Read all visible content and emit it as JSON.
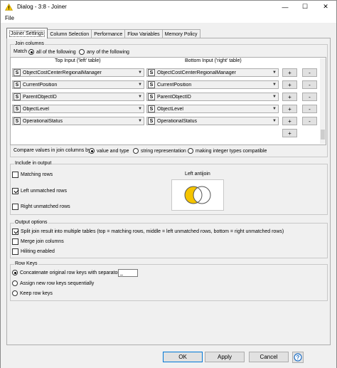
{
  "window": {
    "title": "Dialog - 3:8 - Joiner",
    "minimize_glyph": "—",
    "maximize_glyph": "☐",
    "close_glyph": "✕"
  },
  "menu": {
    "file": "File"
  },
  "tabs": [
    {
      "label": "Joiner Settings",
      "active": true
    },
    {
      "label": "Column Selection"
    },
    {
      "label": "Performance"
    },
    {
      "label": "Flow Variables"
    },
    {
      "label": "Memory Policy"
    }
  ],
  "join_columns": {
    "legend": "Join columns",
    "match_label": "Match",
    "match_all": "all of the following",
    "match_any": "any of the following",
    "top_header": "Top Input ('left' table)",
    "bottom_header": "Bottom Input ('right' table)",
    "type_badge": "S",
    "add_label": "+",
    "remove_label": "-",
    "rows": [
      {
        "left": "ObjectCostCenterRegionalManager",
        "right": "ObjectCostCenterRegionalManager"
      },
      {
        "left": "CurrentPosition",
        "right": "CurrentPosition"
      },
      {
        "left": "ParentObjectID",
        "right": "ParentObjectID"
      },
      {
        "left": "ObjectLevel",
        "right": "ObjectLevel"
      },
      {
        "left": "OperationalStatus",
        "right": "OperationalStatus"
      }
    ],
    "compare_label": "Compare values in join columns by",
    "compare_value_type": "value and type",
    "compare_string": "string representation",
    "compare_integer": "making integer types compatible"
  },
  "include_output": {
    "legend": "Include in output",
    "matching_rows": "Matching rows",
    "left_unmatched": "Left unmatched rows",
    "right_unmatched": "Right unmatched rows",
    "venn_title": "Left antijoin",
    "venn_color": "#f5c400"
  },
  "output_options": {
    "legend": "Output options",
    "split_result": "Split join result into multiple tables (top = matching rows, middle = left unmatched rows, bottom = right unmatched rows)",
    "merge_columns": "Merge join columns",
    "hiliting": "Hiliting enabled"
  },
  "row_keys": {
    "legend": "Row Keys",
    "concatenate": "Concatenate original row keys with separator",
    "separator_value": "_",
    "assign_new": "Assign new row keys sequentially",
    "keep": "Keep row keys"
  },
  "footer": {
    "ok": "OK",
    "apply": "Apply",
    "cancel": "Cancel",
    "help_glyph": "?"
  },
  "colors": {
    "accent": "#0078d7",
    "warning_icon": "#f2c200"
  }
}
